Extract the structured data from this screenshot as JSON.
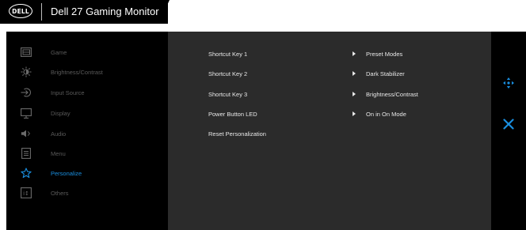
{
  "header": {
    "logo": "DELL",
    "title": "Dell 27 Gaming Monitor"
  },
  "sidebar": {
    "items": [
      {
        "label": "Game",
        "icon": "game-icon"
      },
      {
        "label": "Brightness/Contrast",
        "icon": "brightness-icon"
      },
      {
        "label": "Input Source",
        "icon": "input-source-icon"
      },
      {
        "label": "Display",
        "icon": "display-icon"
      },
      {
        "label": "Audio",
        "icon": "audio-icon"
      },
      {
        "label": "Menu",
        "icon": "menu-icon"
      },
      {
        "label": "Personalize",
        "icon": "star-icon",
        "active": true
      },
      {
        "label": "Others",
        "icon": "others-icon"
      }
    ]
  },
  "content": {
    "rows": [
      {
        "label": "Shortcut Key 1",
        "value": "Preset Modes"
      },
      {
        "label": "Shortcut Key 2",
        "value": "Dark Stabilizer"
      },
      {
        "label": "Shortcut Key 3",
        "value": "Brightness/Contrast"
      },
      {
        "label": "Power Button LED",
        "value": "On in On Mode"
      },
      {
        "label": "Reset Personalization",
        "value": ""
      }
    ]
  },
  "nav": {
    "move_icon": "four-way-arrow-icon",
    "close_icon": "close-icon"
  },
  "colors": {
    "accent": "#1a8fe0",
    "panel": "#2b2b2b",
    "background": "#000000",
    "inactive_text": "#5a5a5a"
  }
}
